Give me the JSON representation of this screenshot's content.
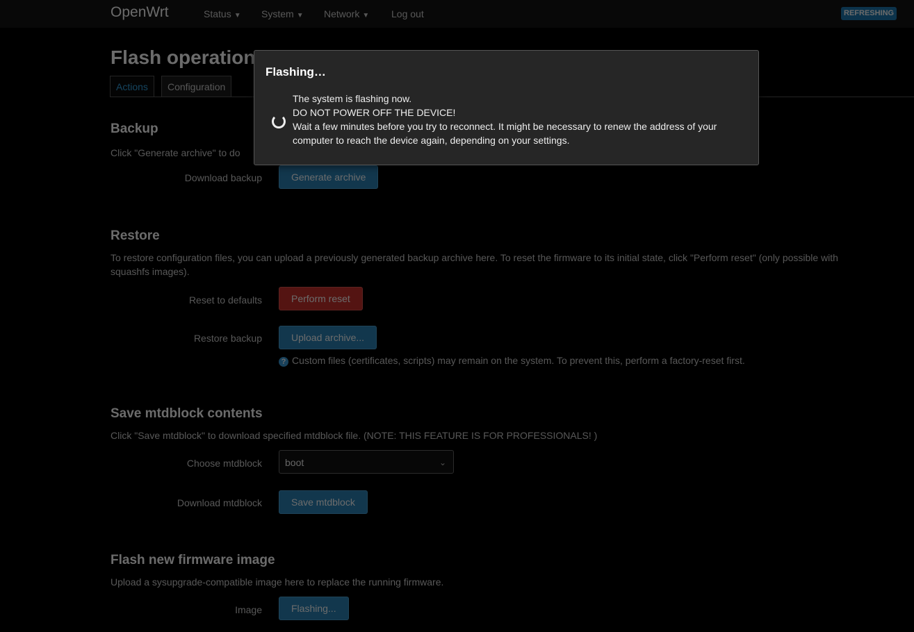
{
  "header": {
    "brand": "OpenWrt",
    "nav": [
      {
        "label": "Status",
        "has_menu": true
      },
      {
        "label": "System",
        "has_menu": true
      },
      {
        "label": "Network",
        "has_menu": true
      },
      {
        "label": "Log out",
        "has_menu": false
      }
    ],
    "status_badge": "REFRESHING"
  },
  "page": {
    "title": "Flash operations",
    "tabs": [
      {
        "label": "Actions",
        "active": true
      },
      {
        "label": "Configuration",
        "active": false
      }
    ]
  },
  "backup": {
    "title": "Backup",
    "description": "Click \"Generate archive\" to do",
    "download_label": "Download backup",
    "generate_button": "Generate archive"
  },
  "restore": {
    "title": "Restore",
    "description": "To restore configuration files, you can upload a previously generated backup archive here. To reset the firmware to its initial state, click \"Perform reset\" (only possible with squashfs images).",
    "reset_label": "Reset to defaults",
    "reset_button": "Perform reset",
    "restore_label": "Restore backup",
    "upload_button": "Upload archive...",
    "hint": "Custom files (certificates, scripts) may remain on the system. To prevent this, perform a factory-reset first."
  },
  "mtdblock": {
    "title": "Save mtdblock contents",
    "description": "Click \"Save mtdblock\" to download specified mtdblock file. (NOTE: THIS FEATURE IS FOR PROFESSIONALS! )",
    "choose_label": "Choose mtdblock",
    "selected": "boot",
    "download_label": "Download mtdblock",
    "save_button": "Save mtdblock"
  },
  "firmware": {
    "title": "Flash new firmware image",
    "description": "Upload a sysupgrade-compatible image here to replace the running firmware.",
    "image_label": "Image",
    "flash_button": "Flashing..."
  },
  "modal": {
    "title": "Flashing…",
    "line1": "The system is flashing now.",
    "line2": "DO NOT POWER OFF THE DEVICE!",
    "line3": "Wait a few minutes before you try to reconnect. It might be necessary to renew the address of your computer to reach the device again, depending on your settings."
  },
  "colors": {
    "accent": "#31a3e3",
    "button_blue": "#2a84b8",
    "button_red": "#c9302c"
  }
}
